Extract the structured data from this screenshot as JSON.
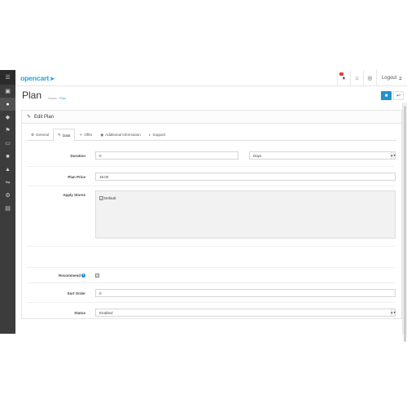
{
  "header": {
    "logo_text": "opencart",
    "logout_label": "Logout"
  },
  "page": {
    "title": "Plan",
    "breadcrumb": [
      "Home",
      "Plan"
    ]
  },
  "panel": {
    "title": "Edit Plan"
  },
  "tabs": [
    {
      "label": "General",
      "icon": "gear-icon"
    },
    {
      "label": "Data",
      "icon": "wrench-icon",
      "active": true
    },
    {
      "label": "Offer",
      "icon": "users-icon"
    },
    {
      "label": "Additional Information",
      "icon": "info-icon"
    },
    {
      "label": "Support",
      "icon": "support-icon"
    }
  ],
  "form": {
    "duration_label": "Duration",
    "duration_value": "0",
    "duration_unit": "Days",
    "price_label": "Plan Price",
    "price_value": "19.00",
    "stores_label": "Apply Stores",
    "store_default": "Default",
    "store_default_checked": true,
    "recommend_label": "Recommend",
    "recommend_checked": true,
    "sort_label": "Sort Order",
    "sort_value": "0",
    "status_label": "Status",
    "status_value": "Enabled"
  },
  "colors": {
    "accent": "#1e91cf",
    "sidebar": "#3c3c3c",
    "notification": "#e23c2f"
  }
}
